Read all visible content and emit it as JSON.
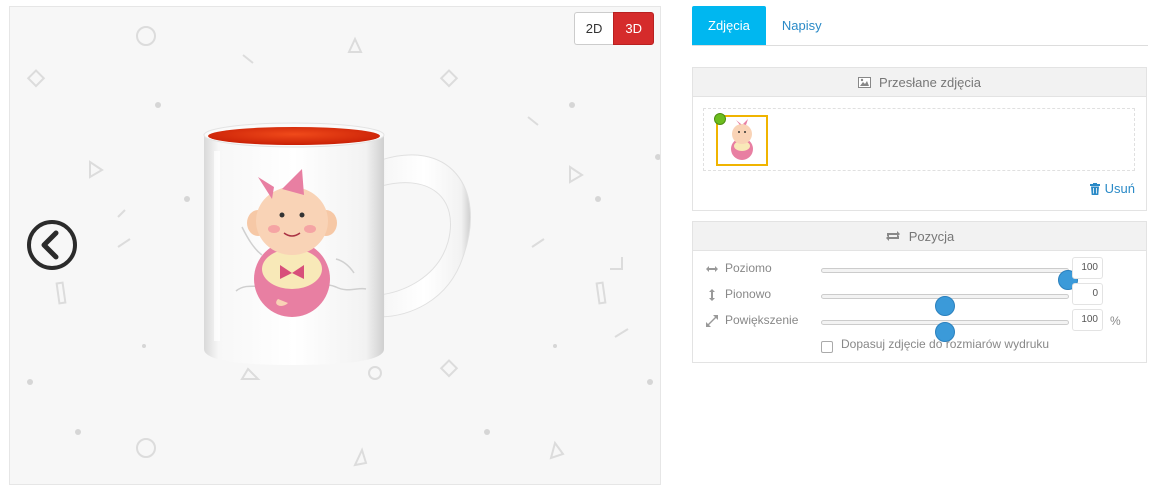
{
  "viewer": {
    "view_2d_label": "2D",
    "view_3d_label": "3D",
    "active_view": "3D",
    "prev_icon": "circle-chevron-left-icon",
    "mug_inner_color": "#e32a0a",
    "mug_body_color": "#ffffff"
  },
  "panel": {
    "tabs": [
      {
        "label": "Zdjęcia",
        "active": true
      },
      {
        "label": "Napisy",
        "active": false
      }
    ],
    "uploads": {
      "title": "Przesłane zdjęcia",
      "title_icon": "image-icon",
      "remove_label": "Usuń",
      "remove_icon": "trash-icon",
      "selected_badge_color": "#6cbd1e"
    },
    "position": {
      "title": "Pozycja",
      "title_icon": "repeat-icon",
      "horizontal": {
        "label": "Poziomo",
        "value": "100",
        "level": 1.0,
        "icon": "arrows-horizontal-icon"
      },
      "vertical": {
        "label": "Pionowo",
        "value": "0",
        "level": 0.5,
        "icon": "arrows-vertical-icon"
      },
      "scale": {
        "label": "Powiększenie",
        "value": "100",
        "unit": "%",
        "level": 0.5,
        "icon": "expand-diagonal-icon"
      },
      "fit_label": "Dopasuj zdjęcie do rozmiarów wydruku",
      "fit_checked": false
    },
    "accent_color": "#00b7f0",
    "slider_color": "#3b9ad9"
  }
}
